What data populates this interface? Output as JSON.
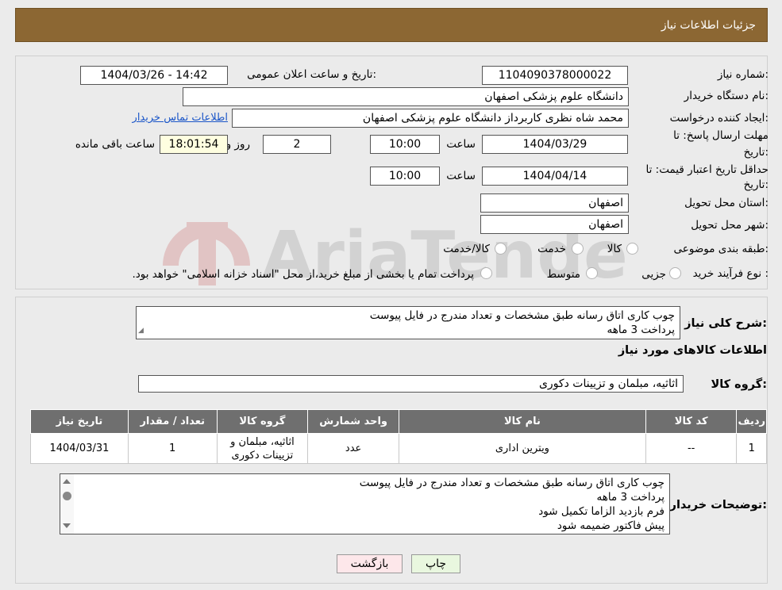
{
  "header": {
    "title": "جزئیات اطلاعات نیاز"
  },
  "form": {
    "need_number_label": "شماره نیاز:",
    "need_number": "1104090378000022",
    "announce_label": "تاریخ و ساعت اعلان عمومی:",
    "announce_value": "1404/03/26 - 14:42",
    "buyer_org_label": "نام دستگاه خریدار:",
    "buyer_org": "دانشگاه علوم پزشکی اصفهان",
    "creator_label": "ایجاد کننده درخواست:",
    "creator": "محمد شاه نظری کاربرداز دانشگاه علوم پزشکی اصفهان",
    "contact_link": "اطلاعات تماس خریدار",
    "reply_deadline_label_1": "مهلت ارسال پاسخ: تا",
    "reply_deadline_label_2": "تاریخ:",
    "reply_date": "1404/03/29",
    "time_label": "ساعت",
    "reply_time": "10:00",
    "days_value": "2",
    "days_label": "روز و",
    "remaining_time": "18:01:54",
    "remaining_label": "ساعت باقی مانده",
    "price_valid_label_1": "حداقل تاریخ اعتبار قیمت: تا",
    "price_valid_label_2": "تاریخ:",
    "price_valid_date": "1404/04/14",
    "price_valid_time": "10:00",
    "province_label": "استان محل تحویل:",
    "province": "اصفهان",
    "city_label": "شهر محل تحویل:",
    "city": "اصفهان",
    "category_label": "طبقه بندی موضوعی:",
    "category_options": [
      "کالا",
      "خدمت",
      "کالا/خدمت"
    ],
    "process_label": "نوع فرآیند خرید :",
    "process_options": [
      "جزیی",
      "متوسط"
    ],
    "process_note": "پرداخت تمام یا بخشی از مبلغ خرید،از محل \"اسناد خزانه اسلامی\" خواهد بود."
  },
  "summary": {
    "label": "شرح کلی نیاز:",
    "lines": [
      "چوب کاری اتاق رسانه طبق مشخصات و تعداد مندرج در فایل پیوست",
      "پرداخت 3 ماهه"
    ],
    "goods_info_title": "اطلاعات کالاهای مورد نیاز",
    "goods_group_label": "گروه کالا:",
    "goods_group": "اثاثیه، مبلمان و تزیینات دکوری"
  },
  "table": {
    "headers": [
      "ردیف",
      "کد کالا",
      "نام کالا",
      "واحد شمارش",
      "گروه کالا",
      "تعداد / مقدار",
      "تاریخ نیاز"
    ],
    "rows": [
      {
        "row": "1",
        "code": "--",
        "name": "ویترین اداری",
        "unit": "عدد",
        "group": "اثاثیه، مبلمان و تزیینات دکوری",
        "qty": "1",
        "date": "1404/03/31"
      }
    ]
  },
  "buyer_notes": {
    "label": "توضیحات خریدار:",
    "lines": [
      "چوب کاری اتاق رسانه طبق مشخصات و تعداد مندرج در فایل پیوست",
      "پرداخت 3 ماهه",
      "فرم بازدید الزاما تکمیل شود",
      "پیش فاکتور ضمیمه شود"
    ]
  },
  "buttons": {
    "print": "چاپ",
    "back": "بازگشت"
  },
  "colors": {
    "header_bg": "#8c6733",
    "table_header_bg": "#6f6f6f",
    "link": "#1a55c8",
    "back_btn": "#fde7ea",
    "print_btn": "#e9f7df"
  }
}
